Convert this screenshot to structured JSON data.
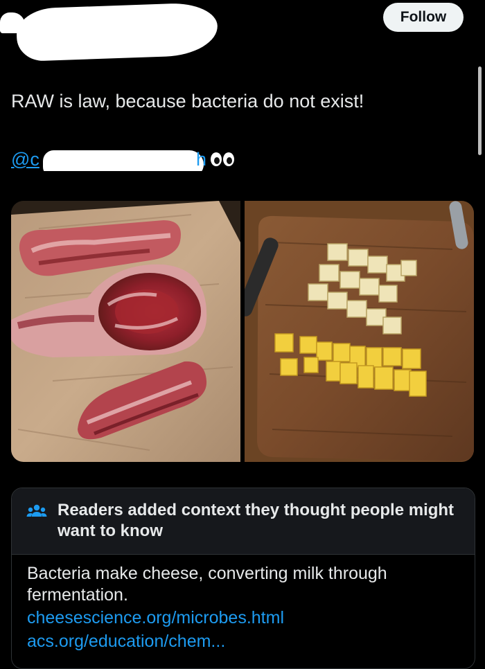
{
  "header": {
    "follow_label": "Follow"
  },
  "tweet": {
    "text": "RAW is law, because bacteria do not exist!",
    "mention_prefix": "@c",
    "mention_suffix": "h",
    "emoji": "👀"
  },
  "media": {
    "photos": [
      {
        "subject": "raw steaks on butcher paper"
      },
      {
        "subject": "cubed cheese on wooden tray"
      }
    ]
  },
  "community_note": {
    "title": "Readers added context they thought people might want to know",
    "body": "Bacteria make cheese, converting milk  through fermentation.",
    "links": [
      "cheesescience.org/microbes.html",
      "acs.org/education/chem..."
    ]
  },
  "icons": {
    "note_icon": "people-icon",
    "eyes": "eyes-icon"
  },
  "colors": {
    "background": "#000000",
    "text": "#e7e9ea",
    "link": "#1d9bf0",
    "follow_bg": "#eff3f4",
    "note_header_bg": "#16181c",
    "note_border": "#2f3336"
  }
}
